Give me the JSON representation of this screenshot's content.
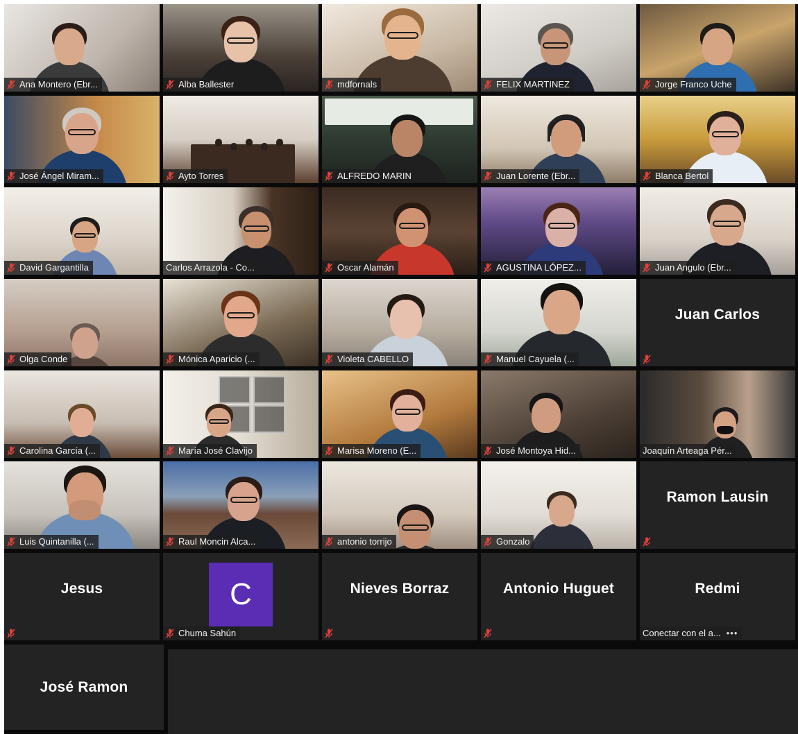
{
  "gallery": {
    "tiles": [
      {
        "name": "Ana Montero (Ebr...",
        "muted": true,
        "kind": "video"
      },
      {
        "name": "Alba Ballester",
        "muted": true,
        "kind": "video"
      },
      {
        "name": "mdfornals",
        "muted": true,
        "kind": "video"
      },
      {
        "name": "FELIX MARTINEZ",
        "muted": true,
        "kind": "video"
      },
      {
        "name": "Jorge Franco Uche",
        "muted": true,
        "kind": "video"
      },
      {
        "name": "José Ángel Miram...",
        "muted": true,
        "kind": "video"
      },
      {
        "name": "Ayto Torres",
        "muted": true,
        "kind": "video"
      },
      {
        "name": "ALFREDO MARIN",
        "muted": true,
        "kind": "video"
      },
      {
        "name": "Juan Lorente (Ebr...",
        "muted": true,
        "kind": "video"
      },
      {
        "name": "Blanca Bertol",
        "muted": true,
        "kind": "video"
      },
      {
        "name": "David Gargantilla",
        "muted": true,
        "kind": "video"
      },
      {
        "name": "Carlos Arrazola - Co...",
        "muted": false,
        "kind": "video",
        "speaking": true
      },
      {
        "name": "Oscar Alamán",
        "muted": true,
        "kind": "video"
      },
      {
        "name": "AGUSTINA LÓPEZ...",
        "muted": true,
        "kind": "video"
      },
      {
        "name": "Juan Angulo (Ebr...",
        "muted": true,
        "kind": "video"
      },
      {
        "name": "Olga Conde",
        "muted": true,
        "kind": "video"
      },
      {
        "name": "Mónica Aparicio (...",
        "muted": true,
        "kind": "video"
      },
      {
        "name": "Violeta CABELLO",
        "muted": true,
        "kind": "video"
      },
      {
        "name": "Manuel Cayuela (...",
        "muted": true,
        "kind": "video"
      },
      {
        "display": "Juan Carlos",
        "muted": true,
        "kind": "name"
      },
      {
        "name": "Carolina García (...",
        "muted": true,
        "kind": "video"
      },
      {
        "name": "María José Clavijo",
        "muted": true,
        "kind": "video"
      },
      {
        "name": "Marisa Moreno (E...",
        "muted": true,
        "kind": "video"
      },
      {
        "name": "José Montoya Hid...",
        "muted": true,
        "kind": "video"
      },
      {
        "name": "Joaquín Arteaga Pér...",
        "muted": false,
        "kind": "video"
      },
      {
        "name": "Luis Quintanilla (...",
        "muted": true,
        "kind": "video"
      },
      {
        "name": "Raul Moncin Alca...",
        "muted": true,
        "kind": "video"
      },
      {
        "name": "antonio torrijo",
        "muted": true,
        "kind": "video"
      },
      {
        "name": "Gonzalo",
        "muted": true,
        "kind": "video"
      },
      {
        "display": "Ramon Lausin",
        "muted": true,
        "kind": "name"
      },
      {
        "display": "Jesus",
        "muted": true,
        "kind": "name"
      },
      {
        "name": "Chuma Sahún",
        "avatar_letter": "C",
        "avatar_color": "#5b2db5",
        "muted": true,
        "kind": "avatar"
      },
      {
        "display": "Nieves Borraz",
        "muted": true,
        "kind": "name"
      },
      {
        "display": "Antonio Huguet",
        "muted": true,
        "kind": "name"
      },
      {
        "display": "Redmi",
        "name": "Conectar con el a...",
        "more": "•••",
        "muted": false,
        "kind": "name-phone"
      },
      {
        "display": "José Ramon",
        "muted": false,
        "kind": "name-nobar"
      }
    ]
  },
  "colors": {
    "tile_bg": "#232323",
    "gallery_bg": "#0a0a0a",
    "speaking_outline": "#c4d94a",
    "muted_icon": "#e0413a"
  },
  "icons": {
    "muted": "mic-muted-icon",
    "more": "more-options-icon"
  }
}
